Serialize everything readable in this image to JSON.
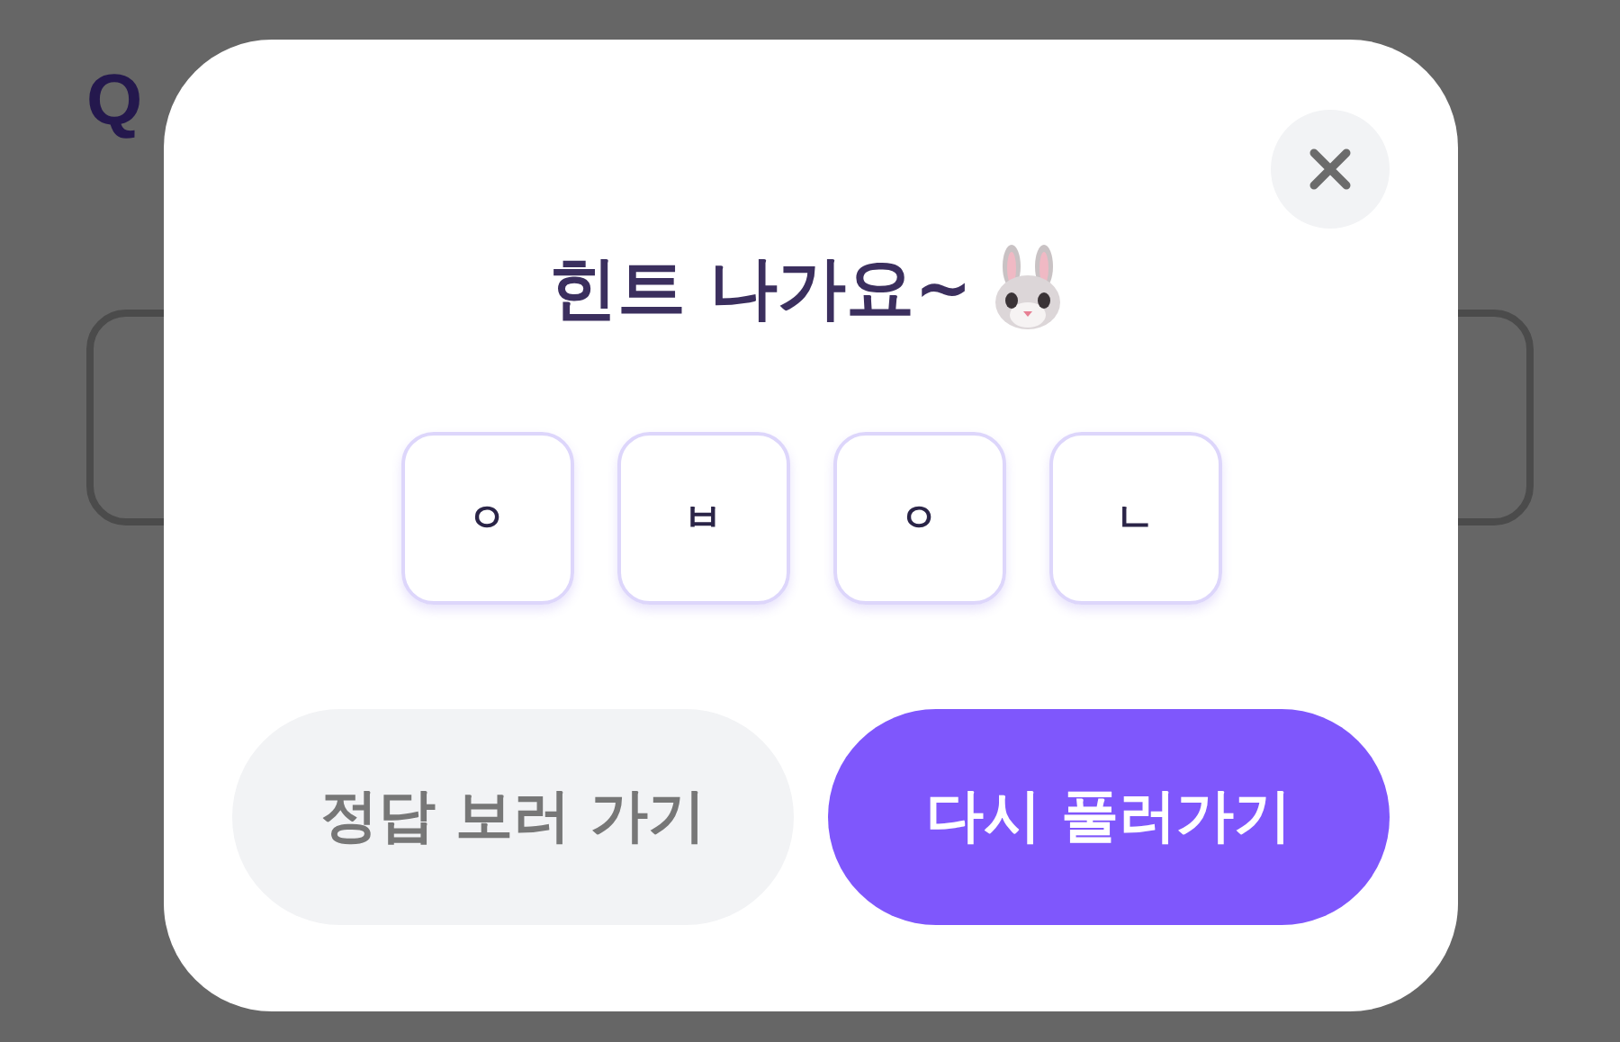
{
  "background": {
    "question_mark": "Q"
  },
  "dialog": {
    "title": "힌트 나가요~",
    "hint_letters": [
      "ㅇ",
      "ㅂ",
      "ㅇ",
      "ㄴ"
    ],
    "buttons": [
      {
        "label": "정답 보러 가기",
        "kind": "secondary"
      },
      {
        "label": "다시 풀러가기",
        "kind": "primary"
      }
    ]
  }
}
